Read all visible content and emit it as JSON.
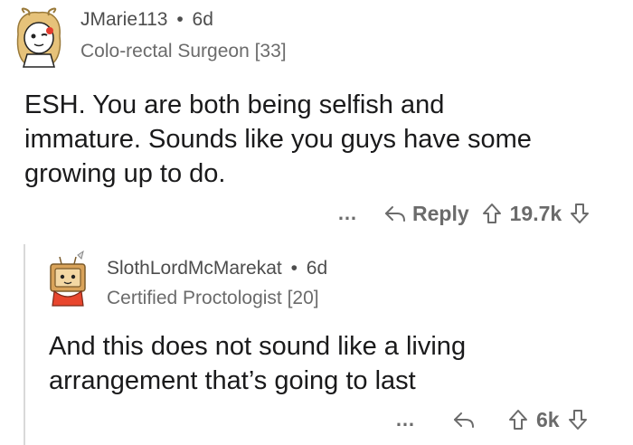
{
  "comments": [
    {
      "username": "JMarie113",
      "separator": "•",
      "age": "6d",
      "flair": "Colo-rectal Surgeon [33]",
      "avatar_icon": "avatar-icon",
      "body_lines": [
        "ESH. You are both being selfish and",
        "immature. Sounds like you guys have some",
        "growing up to do."
      ],
      "more_label": "…",
      "reply_label": "Reply",
      "score": "19.7k"
    },
    {
      "username": "SlothLordMcMarekat",
      "separator": "•",
      "age": "6d",
      "flair": "Certified Proctologist [20]",
      "avatar_icon": "avatar-icon",
      "body_lines": [
        "And this does not sound like a living",
        "arrangement that’s going to last"
      ],
      "more_label": "…",
      "score": "6k"
    }
  ],
  "colors": {
    "text": "#1a1a1b",
    "meta": "#6b6b6b",
    "thread_line": "#d9d9d9"
  }
}
